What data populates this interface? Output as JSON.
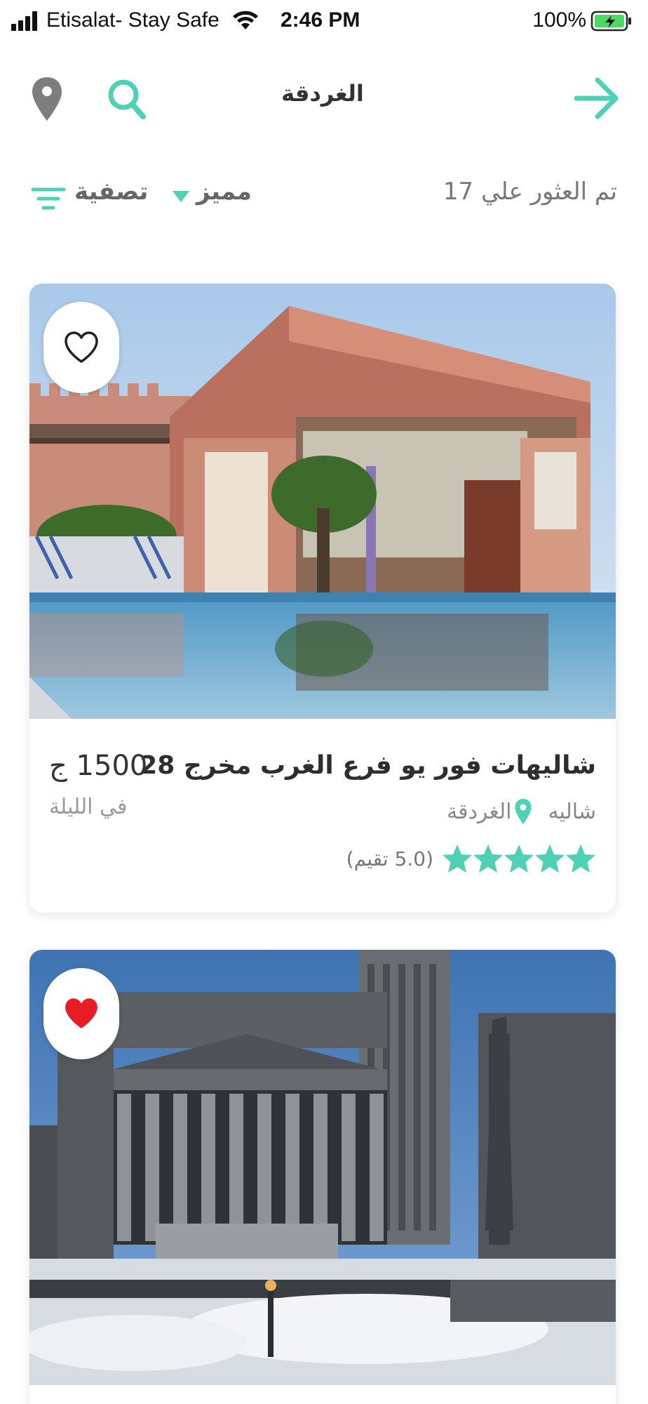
{
  "status_bar": {
    "carrier": "Etisalat- Stay Safe",
    "time": "2:46 PM",
    "battery": "100%"
  },
  "header": {
    "title": "الغردقة"
  },
  "filter_bar": {
    "results": "تم العثور علي 17",
    "sort": "مميز",
    "filter": "تصفية"
  },
  "listings": [
    {
      "title": "شاليهات فور يو فرع الغرب مخرج 28",
      "type": "شاليه",
      "location": "الغردقة",
      "stars": 5,
      "rating": "(5.0 تقيم)",
      "price": "1500 ج",
      "per": "في الليلة",
      "favorited": false
    },
    {
      "favorited": true
    }
  ],
  "colors": {
    "accent": "#4fd1b5",
    "favorite_red": "#e81c24",
    "icon_gray": "#7d7d7d"
  },
  "icons": [
    "location-icon",
    "search-icon",
    "arrow-icon",
    "filter-icon",
    "heart-outline-icon",
    "heart-filled-icon",
    "pin-icon",
    "star-icon"
  ]
}
